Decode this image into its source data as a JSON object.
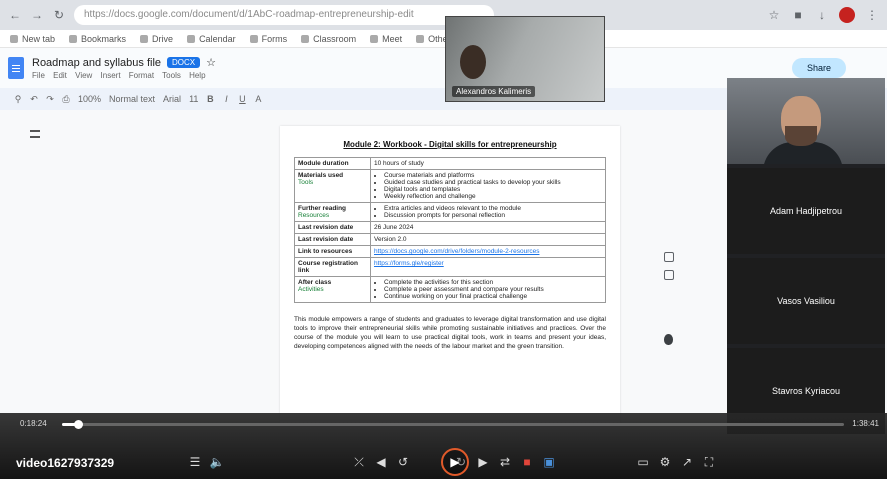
{
  "browser": {
    "address": "https://docs.google.com/document/d/1AbC-roadmap-entrepreneurship-edit",
    "bookmarks": [
      "New tab",
      "Bookmarks",
      "Drive",
      "Calendar",
      "Forms",
      "Classroom",
      "Meet",
      "Other bookmarks"
    ]
  },
  "doc": {
    "title": "Roadmap and syllabus file",
    "badge": "DOCX",
    "menu": "File Edit View Insert Format Tools Help",
    "share_label": "Share",
    "zoom": "100%",
    "style": "Normal text",
    "font": "Arial",
    "font_size": "11"
  },
  "content": {
    "heading": "Module 2: Workbook - Digital skills for entrepreneurship",
    "rows": [
      {
        "key": "Module duration",
        "link": "",
        "value": "10 hours of study",
        "bullets": []
      },
      {
        "key": "Materials used",
        "link": "Tools",
        "value": "",
        "bullets": [
          "Course materials and platforms",
          "Guided case studies and practical tasks to develop your skills",
          "Digital tools and templates",
          "Weekly reflection and challenge"
        ]
      },
      {
        "key": "Further reading",
        "link": "Resources",
        "value": "",
        "bullets": [
          "Extra articles and videos relevant to the module",
          "Discussion prompts for personal reflection"
        ]
      },
      {
        "key": "Last revision date",
        "link": "",
        "value": "26 June 2024",
        "bullets": []
      },
      {
        "key": "Last revision date",
        "link": "",
        "value": "Version 2.0",
        "bullets": []
      },
      {
        "key": "Link to resources",
        "link": "",
        "value": "https://docs.google.com/drive/folders/module-2-resources",
        "bullets": []
      },
      {
        "key": "Course registration link",
        "link": "",
        "value": "https://forms.gle/register",
        "bullets": []
      },
      {
        "key": "After class",
        "link": "Activities",
        "value": "",
        "bullets": [
          "Complete the activities for this section",
          "Complete a peer assessment and compare your results",
          "Continue working on your final practical challenge"
        ]
      }
    ],
    "paragraph": "This module empowers a range of students and graduates to leverage digital transformation and use digital tools to improve their entrepreneurial skills while promoting sustainable initiatives and practices. Over the course of the module you will learn to use practical digital tools, work in teams and present your ideas, developing competences aligned with the needs of the labour market and the green transition."
  },
  "call": {
    "pip_name": "Alexandros Kalimeris",
    "tiles": [
      {
        "name": "",
        "type": "camera",
        "tag": ""
      },
      {
        "name": "Adam Hadjipetrou",
        "type": "name"
      },
      {
        "name": "Vasos Vasiliou",
        "type": "name"
      },
      {
        "name": "Stavros Kyriacou",
        "type": "name"
      }
    ]
  },
  "player": {
    "time_elapsed": "0:18:24",
    "time_total": "1:38:41",
    "progress": 0.02,
    "video_title": "video1627937329"
  }
}
